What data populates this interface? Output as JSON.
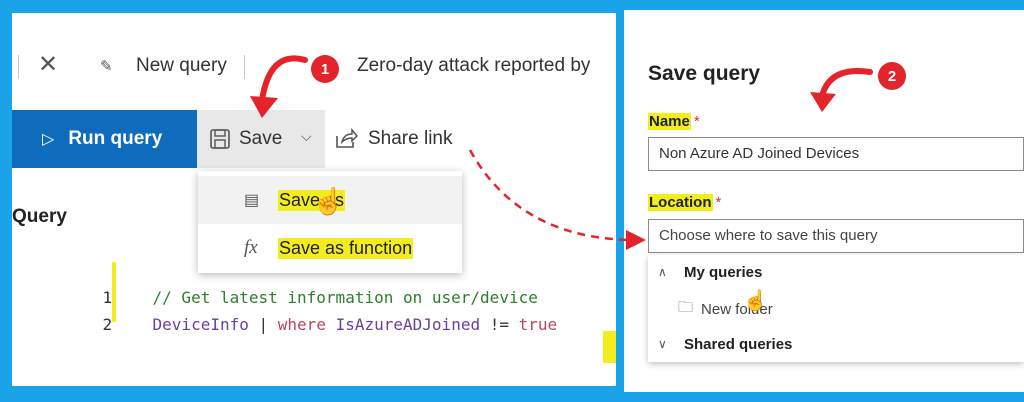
{
  "tabs": {
    "new_query": "New query",
    "active_tab": "Zero-day attack reported by"
  },
  "toolbar": {
    "run_query": "Run query",
    "save": "Save",
    "share_link": "Share link"
  },
  "save_menu": {
    "items": [
      {
        "label": "Save as",
        "icon": "save-as-icon"
      },
      {
        "label": "Save as function",
        "icon": "function-icon"
      }
    ]
  },
  "editor": {
    "heading": "Query",
    "lines": [
      {
        "num": "1",
        "comment": "// Get latest information on user/device"
      },
      {
        "num": "2",
        "table": "DeviceInfo",
        "pipe": "|",
        "where": "where",
        "field": "IsAzureADJoined",
        "op": "!=",
        "value": "true"
      }
    ]
  },
  "save_dialog": {
    "title": "Save query",
    "name_label": "Name",
    "name_value": "Non Azure AD Joined Devices",
    "location_label": "Location",
    "location_placeholder": "Choose where to save this query",
    "required_mark": "*",
    "my_queries": "My queries",
    "new_folder": "New folder",
    "shared_queries": "Shared queries"
  },
  "annotations": {
    "step1": "1",
    "step2": "2"
  },
  "colors": {
    "background": "#1aa3e8",
    "run_button": "#0f6cbd",
    "highlight": "#f2ee1e",
    "callout": "#e3242b"
  }
}
